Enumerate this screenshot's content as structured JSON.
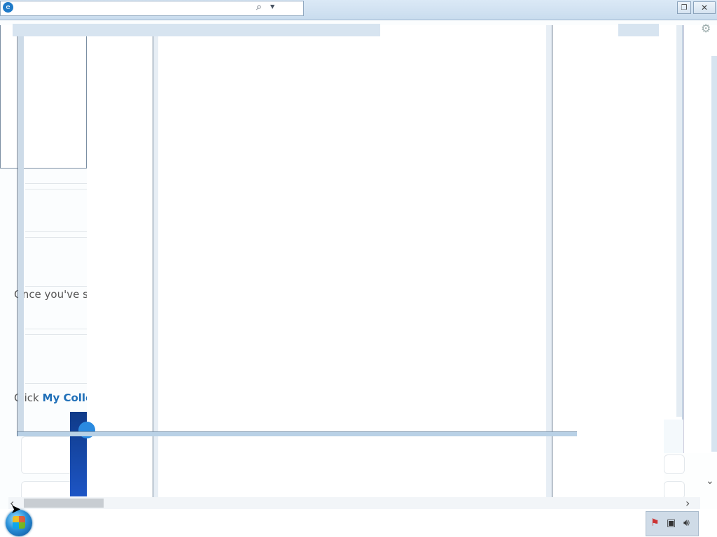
{
  "browser": {
    "logo_icon": "ie-logo",
    "search_icon": "magnifier-icon",
    "dropdown_icon": "chevron-down-icon",
    "restore_label": "❐",
    "close_label": "✕"
  },
  "page": {
    "once_text": "Once you've s",
    "click_prefix": "Click ",
    "click_link": "My Colle"
  },
  "scroll": {
    "left_label": "‹",
    "right_label": "›"
  },
  "taskbar": {
    "tray_icons": [
      "action-center-flag-icon",
      "network-icon",
      "volume-icon"
    ]
  },
  "colors": {
    "accent": "#1f6fb8",
    "frame": "#5f7389",
    "taskbar_bg": "#ffffff"
  }
}
